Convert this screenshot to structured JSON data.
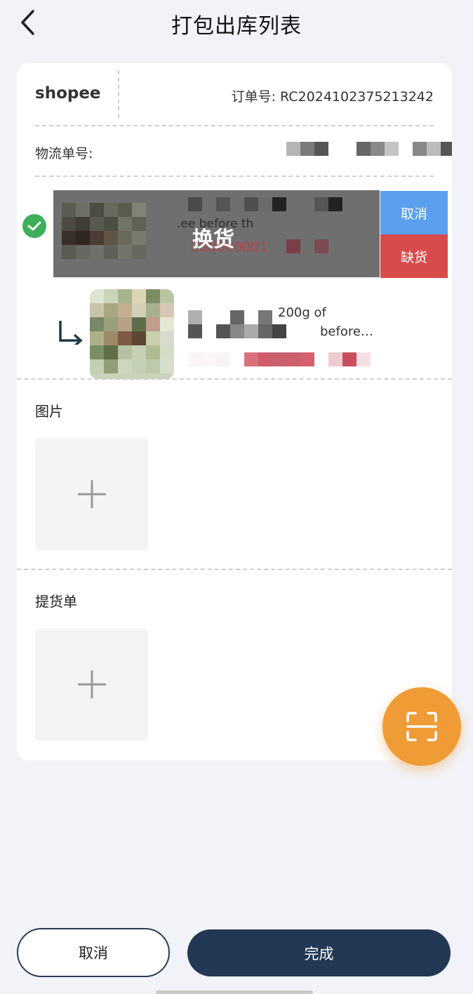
{
  "header": {
    "title": "打包出库列表",
    "back_icon": "chevron-left-icon"
  },
  "order": {
    "platform": "shopee",
    "order_no": "订单号: RC2024102375213242",
    "logistics_label": "物流单号:"
  },
  "item": {
    "overlay_label": "换货",
    "title_fragment": ".ee before th",
    "code_fragment": "3G0000001",
    "actions": {
      "cancel": "取消",
      "out_of_stock": "缺货"
    }
  },
  "sub_item": {
    "text_line1": "200g of",
    "text_line2": "before…"
  },
  "sections": {
    "images_label": "图片",
    "pickup_label": "提货单"
  },
  "footer": {
    "cancel": "取消",
    "done": "完成"
  },
  "colors": {
    "primary": "#223855",
    "success": "#3fae5a",
    "cancel_action": "#5aa0ee",
    "danger": "#d94b4b",
    "fab": "#ef9b36"
  }
}
